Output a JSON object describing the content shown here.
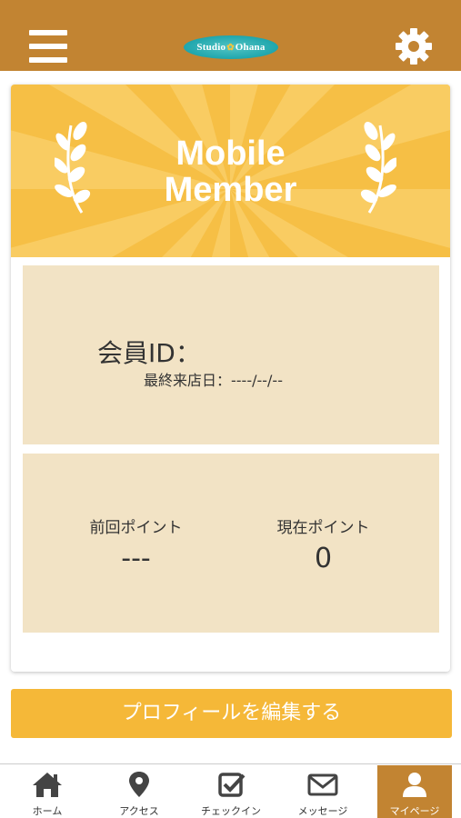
{
  "header": {
    "menu_icon": "hamburger-menu-icon",
    "logo_text_left": "Studio",
    "logo_text_right": "Ohana",
    "settings_icon": "gear-icon",
    "bar_color": "#c28432"
  },
  "card": {
    "banner": {
      "title_line1": "Mobile",
      "title_line2": "Member",
      "color": "#f6bf45"
    },
    "member_id_label": "会員ID：",
    "last_visit_label": "最終来店日：----/--/--",
    "points": {
      "previous_label": "前回ポイント",
      "previous_value": "---",
      "current_label": "現在ポイント",
      "current_value": "0"
    },
    "panel_color": "#f2e3c5"
  },
  "edit_profile_button": "プロフィールを編集する",
  "bottom_nav": {
    "items": [
      {
        "label": "ホーム",
        "icon": "home-icon"
      },
      {
        "label": "アクセス",
        "icon": "map-pin-icon"
      },
      {
        "label": "チェックイン",
        "icon": "checkbox-icon"
      },
      {
        "label": "メッセージ",
        "icon": "envelope-icon"
      },
      {
        "label": "マイページ",
        "icon": "user-icon",
        "active": true
      }
    ]
  }
}
